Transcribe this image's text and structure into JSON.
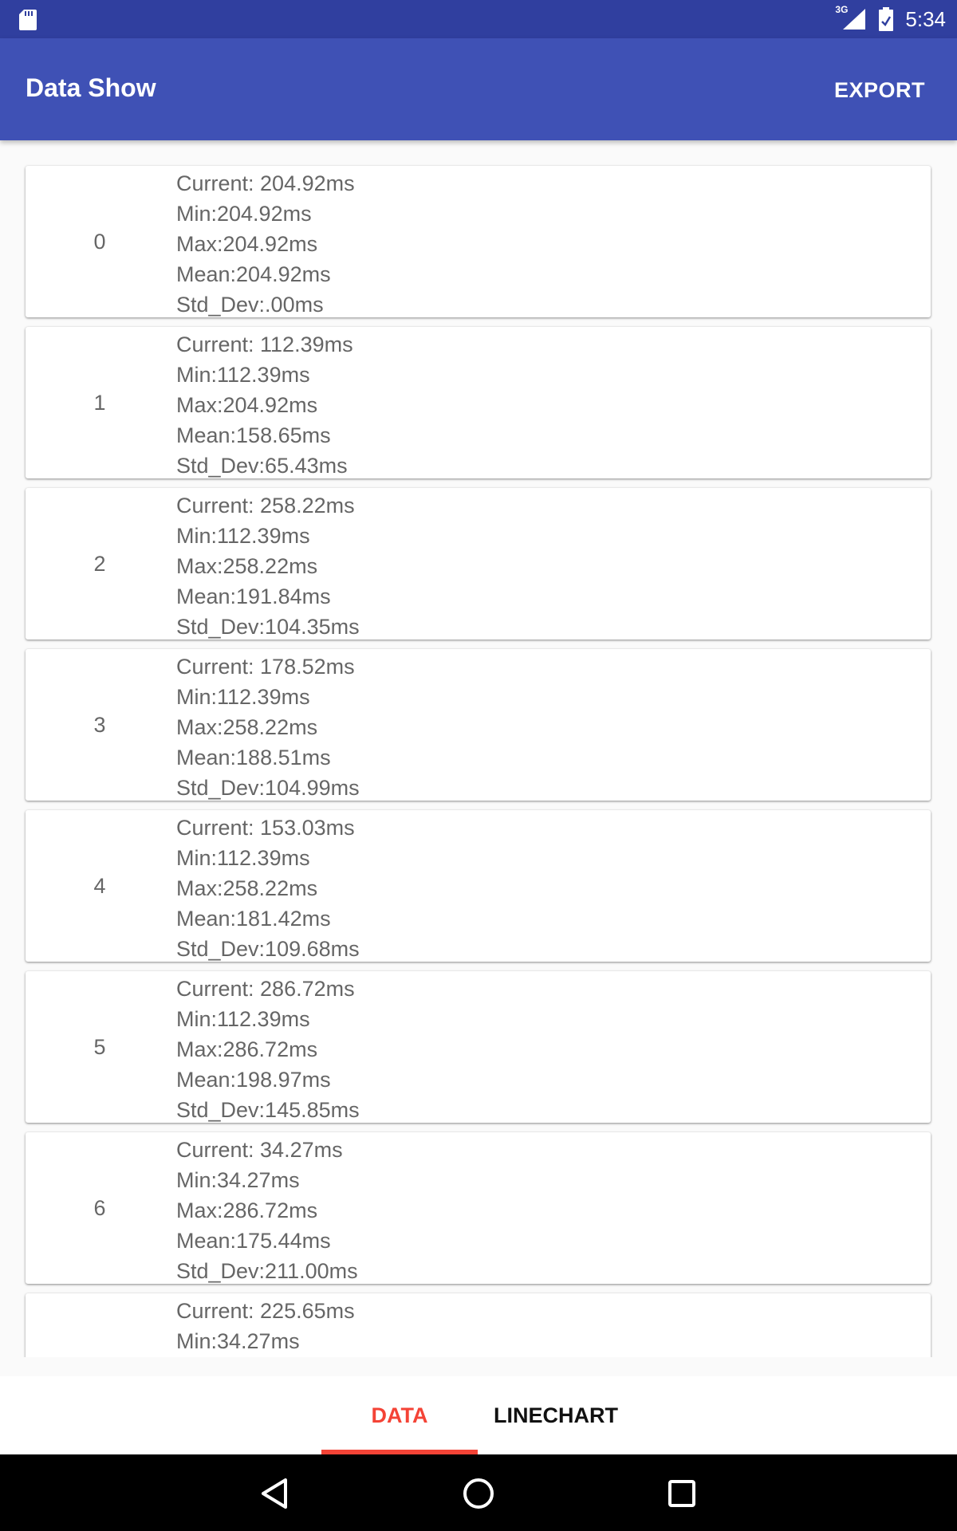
{
  "status_bar": {
    "network": "3G",
    "time": "5:34",
    "icons": [
      "sd-card-icon",
      "signal-icon",
      "battery-icon"
    ]
  },
  "app_bar": {
    "title": "Data Show",
    "export_label": "EXPORT",
    "color": "#3f51b5"
  },
  "items": [
    {
      "index": "0",
      "current": "Current: 204.92ms",
      "min": "Min:204.92ms",
      "max": "Max:204.92ms",
      "mean": "Mean:204.92ms",
      "std_dev": "Std_Dev:.00ms"
    },
    {
      "index": "1",
      "current": "Current: 112.39ms",
      "min": "Min:112.39ms",
      "max": "Max:204.92ms",
      "mean": "Mean:158.65ms",
      "std_dev": "Std_Dev:65.43ms"
    },
    {
      "index": "2",
      "current": "Current: 258.22ms",
      "min": "Min:112.39ms",
      "max": "Max:258.22ms",
      "mean": "Mean:191.84ms",
      "std_dev": "Std_Dev:104.35ms"
    },
    {
      "index": "3",
      "current": "Current: 178.52ms",
      "min": "Min:112.39ms",
      "max": "Max:258.22ms",
      "mean": "Mean:188.51ms",
      "std_dev": "Std_Dev:104.99ms"
    },
    {
      "index": "4",
      "current": "Current: 153.03ms",
      "min": "Min:112.39ms",
      "max": "Max:258.22ms",
      "mean": "Mean:181.42ms",
      "std_dev": "Std_Dev:109.68ms"
    },
    {
      "index": "5",
      "current": "Current: 286.72ms",
      "min": "Min:112.39ms",
      "max": "Max:286.72ms",
      "mean": "Mean:198.97ms",
      "std_dev": "Std_Dev:145.85ms"
    },
    {
      "index": "6",
      "current": "Current: 34.27ms",
      "min": "Min:34.27ms",
      "max": "Max:286.72ms",
      "mean": "Mean:175.44ms",
      "std_dev": "Std_Dev:211.00ms"
    },
    {
      "index": "",
      "current": "Current: 225.65ms",
      "min": "Min:34.27ms",
      "max": "",
      "mean": "",
      "std_dev": ""
    }
  ],
  "tabs": [
    {
      "label": "DATA",
      "active": true,
      "color": "#f44336"
    },
    {
      "label": "LINECHART",
      "active": false
    }
  ],
  "nav_bar": {
    "icons": [
      "back-icon",
      "home-icon",
      "recents-icon"
    ]
  }
}
